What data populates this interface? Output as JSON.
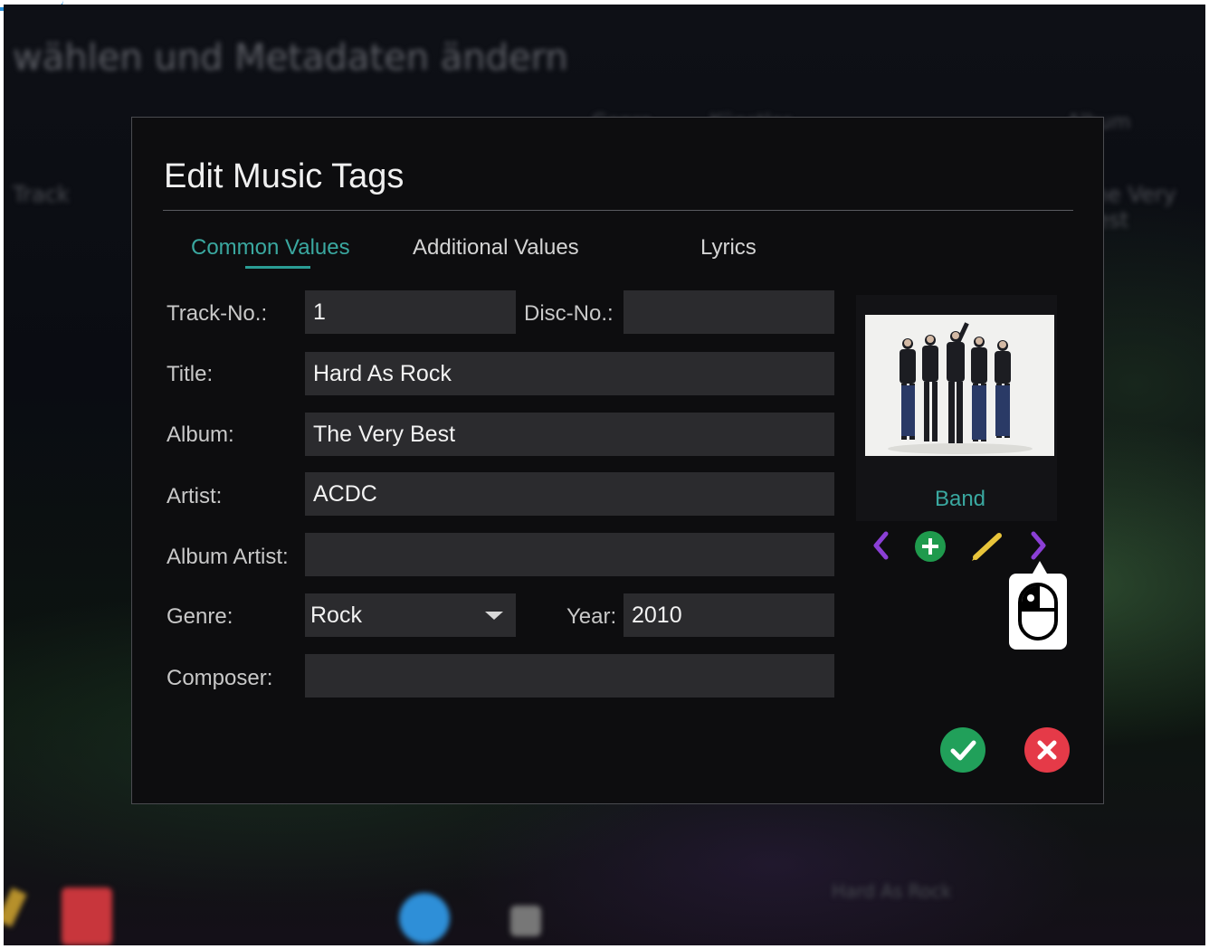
{
  "background": {
    "title": "wählen und Metadaten ändern",
    "tab_a": "Genre",
    "tab_b": "Künstler",
    "tab_c": "Album",
    "column_a": "Track",
    "column_b": "The Very Best",
    "bottom_text": "Hard As Rock"
  },
  "dialog": {
    "title": "Edit Music Tags",
    "tabs": [
      {
        "label": "Common Values"
      },
      {
        "label": "Additional Values"
      },
      {
        "label": "Lyrics"
      }
    ],
    "labels": {
      "track_no": "Track-No.:",
      "disc_no": "Disc-No.:",
      "title": "Title:",
      "album": "Album:",
      "artist": "Artist:",
      "album_artist": "Album Artist:",
      "genre": "Genre:",
      "year": "Year:",
      "composer": "Composer:"
    },
    "values": {
      "track_no": "1",
      "disc_no": "",
      "title": "Hard As Rock",
      "album": "The Very Best",
      "artist": "ACDC",
      "album_artist": "",
      "genre": "Rock",
      "year": "2010",
      "composer": ""
    },
    "cover": {
      "caption": "Band",
      "controls": [
        "chevron-left-icon",
        "add-icon",
        "pencil-icon",
        "chevron-right-icon"
      ],
      "tooltip_icon": "mouse-icon"
    },
    "actions": {
      "confirm_icon": "checkmark-icon",
      "cancel_icon": "close-icon"
    }
  },
  "colors": {
    "accent": "#3aa8a0",
    "field_bg": "#2b2b2e",
    "dialog_bg": "#0d0d0f",
    "confirm": "#21a05a",
    "cancel": "#e53a48",
    "chevron": "#8b3fd6",
    "add": "#1f9a4d",
    "pencil": "#e8c43a"
  }
}
